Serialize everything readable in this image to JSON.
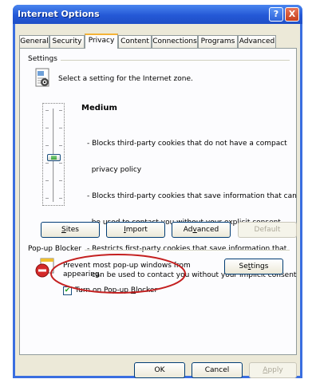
{
  "window": {
    "title": "Internet Options",
    "help_glyph": "?",
    "close_glyph": "X"
  },
  "tabs": [
    {
      "label": "General"
    },
    {
      "label": "Security"
    },
    {
      "label": "Privacy"
    },
    {
      "label": "Content"
    },
    {
      "label": "Connections"
    },
    {
      "label": "Programs"
    },
    {
      "label": "Advanced"
    }
  ],
  "settings": {
    "group_label": "Settings",
    "instruction": "Select a setting for the Internet zone.",
    "level": "Medium",
    "slider_position": "Medium",
    "description_lines": [
      "- Blocks third-party cookies that do not have a compact",
      "  privacy policy",
      "- Blocks third-party cookies that save information that can",
      "  be used to contact you without your explicit consent",
      "- Restricts first-party cookies that save information that",
      "  can be used to contact you without your implicit consent"
    ],
    "buttons": {
      "sites": {
        "first": "S",
        "rest": "ites"
      },
      "import": {
        "first": "I",
        "rest": "mport"
      },
      "advanced": {
        "pre": "Ad",
        "ul": "v",
        "rest": "anced"
      },
      "default": {
        "label": "Default"
      }
    }
  },
  "popup_blocker": {
    "group_label": "Pop-up Blocker",
    "description_line1": "Prevent most pop-up windows from",
    "description_line2": "appearing.",
    "settings_button": {
      "pre": "Se",
      "ul": "t",
      "rest": "tings"
    },
    "checkbox": {
      "checked": true,
      "pre": "Turn on Pop-up ",
      "ul": "B",
      "rest": "locker"
    }
  },
  "footer": {
    "ok": "OK",
    "cancel": "Cancel",
    "apply": {
      "pre": "",
      "ul": "A",
      "rest": "pply"
    }
  },
  "colors": {
    "titlebar": "#2458d6",
    "highlight_circle": "#c42020",
    "accent_tab": "#f5b337"
  }
}
